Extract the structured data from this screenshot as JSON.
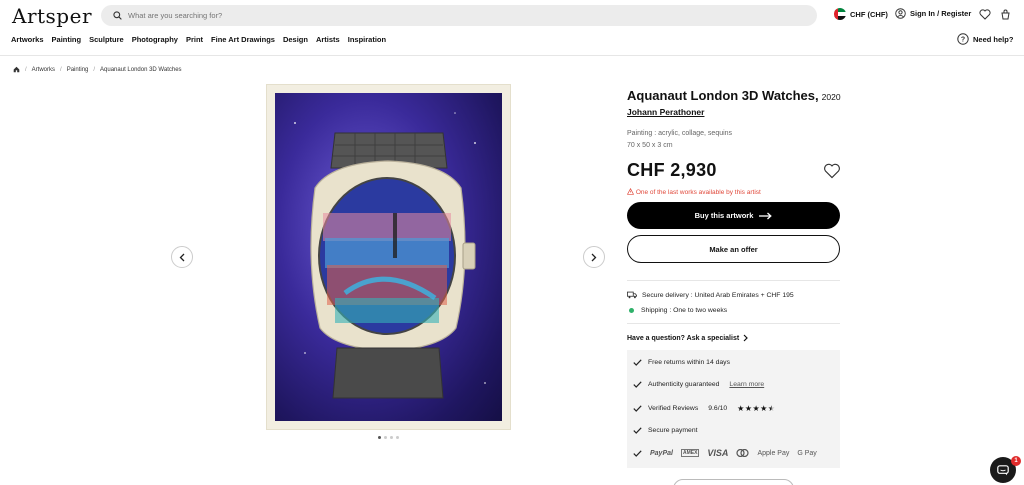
{
  "header": {
    "logo": "Artsper",
    "search_placeholder": "What are you searching for?",
    "currency": "CHF (CHF)",
    "signin": "Sign In / Register",
    "nav": [
      "Artworks",
      "Painting",
      "Sculpture",
      "Photography",
      "Print",
      "Fine Art Drawings",
      "Design",
      "Artists",
      "Inspiration"
    ],
    "help": "Need help?"
  },
  "breadcrumb": [
    "Artworks",
    "Painting",
    "Aquanaut London 3D Watches"
  ],
  "gallery": {
    "image_count": 4,
    "active_index": 0
  },
  "product": {
    "title": "Aquanaut London 3D Watches,",
    "year": "2020",
    "artist": "Johann Perathoner",
    "medium": "Painting : acrylic, collage, sequins",
    "dimensions": "70 x 50 x 3 cm",
    "price": "CHF 2,930",
    "last_works": "One of the last works available by this artist",
    "buy_label": "Buy this artwork",
    "offer_label": "Make an offer"
  },
  "delivery": {
    "secure": "Secure delivery : United Arab Emirates + CHF 195",
    "shipping": "Shipping : One to two weeks"
  },
  "question": "Have a question? Ask a specialist",
  "benefits": {
    "returns": "Free returns within 14 days",
    "authenticity": "Authenticity guaranteed",
    "learn_more": "Learn more",
    "reviews": "Verified Reviews",
    "reviews_score": "9.6/10",
    "rating_stars": 4.5,
    "secure_payment": "Secure payment",
    "payment_methods": [
      "PayPal",
      "AMEX",
      "VISA",
      "mastercard",
      "Apple Pay",
      "G Pay"
    ]
  },
  "chat": {
    "badge": "1"
  },
  "colors": {
    "warning": "#e0493b",
    "shipping_dot": "#2fb16a",
    "buy_button": "#000000",
    "chat_badge": "#e02b2b"
  }
}
